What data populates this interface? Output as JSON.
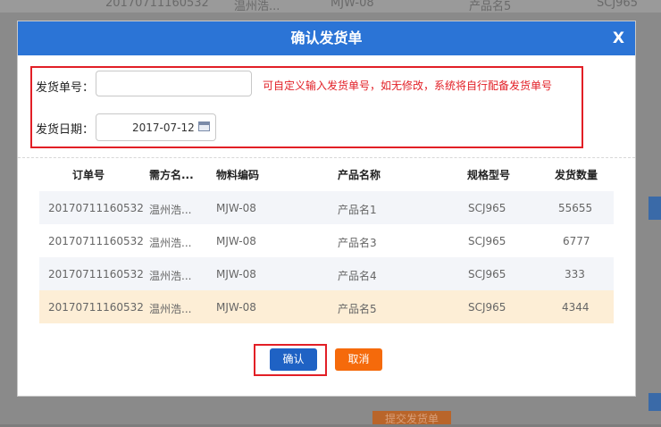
{
  "background": {
    "top_row": [
      "20170711160532",
      "温州浩...",
      "MJW-08",
      "产品名5",
      "SCJ965"
    ],
    "bottom_button": "提交发货单"
  },
  "modal": {
    "title": "确认发货单",
    "close_label": "X",
    "form": {
      "no_label": "发货单号：",
      "no_value": "",
      "hint": "可自定义输入发货单号，如无修改，系统将自行配备发货单号",
      "date_label": "发货日期：",
      "date_value": "2017-07-12"
    },
    "table": {
      "headers": [
        "订单号",
        "需方名...",
        "物料编码",
        "产品名称",
        "规格型号",
        "发货数量"
      ],
      "rows": [
        [
          "20170711160532",
          "温州浩...",
          "MJW-08",
          "产品名1",
          "SCJ965",
          "55655"
        ],
        [
          "20170711160532",
          "温州浩...",
          "MJW-08",
          "产品名3",
          "SCJ965",
          "6777"
        ],
        [
          "20170711160532",
          "温州浩...",
          "MJW-08",
          "产品名4",
          "SCJ965",
          "333"
        ],
        [
          "20170711160532",
          "温州浩...",
          "MJW-08",
          "产品名5",
          "SCJ965",
          "4344"
        ]
      ]
    },
    "buttons": {
      "confirm": "确认",
      "cancel": "取消"
    }
  },
  "colors": {
    "header_blue": "#2b74d6",
    "highlight_red": "#e21f26",
    "confirm_blue": "#1f62c4",
    "cancel_orange": "#f56a0b",
    "selected_row": "#fdeed6"
  }
}
